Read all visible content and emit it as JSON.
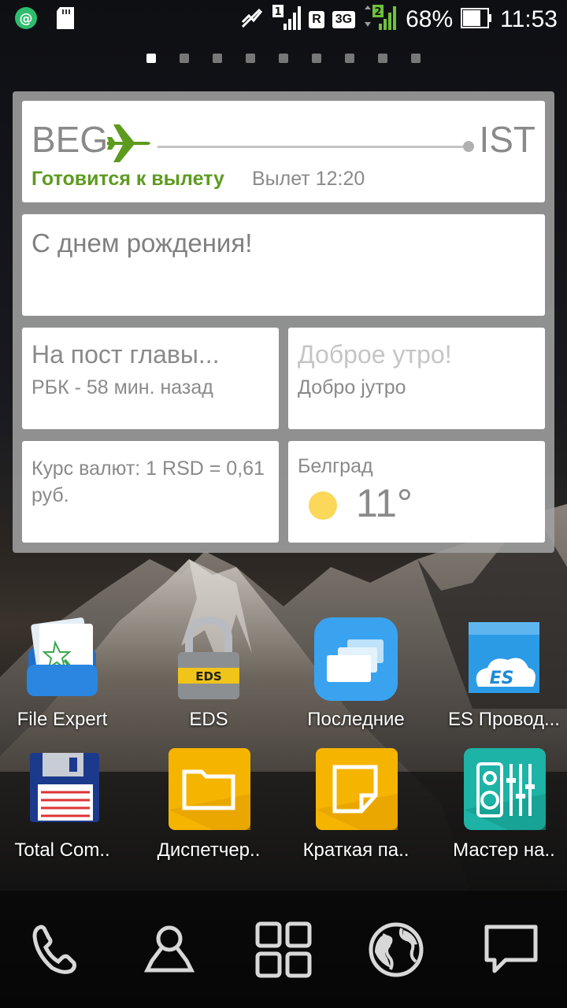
{
  "status_bar": {
    "battery_percent": "68%",
    "time": "11:53",
    "sim1": "1",
    "sim2": "2",
    "roaming": "R",
    "network": "3G"
  },
  "pages": {
    "count": 9,
    "active": 0
  },
  "flight": {
    "from": "BEG",
    "to": "IST",
    "status": "Готовится к вылету",
    "departure": "Вылет 12:20"
  },
  "birthday": {
    "text": "С днем рождения!"
  },
  "news": {
    "title": "На пост главы...",
    "source": "РБК - 58 мин. назад"
  },
  "greeting": {
    "title": "Доброе утро!",
    "translation": "Добро јутро"
  },
  "currency": {
    "text": "Курс валют: 1 RSD = 0,61 руб."
  },
  "weather": {
    "city": "Белград",
    "temperature": "11°"
  },
  "apps": [
    {
      "label": "File Expert",
      "icon": "file-expert-icon"
    },
    {
      "label": "EDS",
      "icon": "eds-lock-icon"
    },
    {
      "label": "Последние",
      "icon": "recents-icon"
    },
    {
      "label": "ES Провод...",
      "icon": "es-explorer-icon"
    },
    {
      "label": "Total Com..",
      "icon": "floppy-disk-icon"
    },
    {
      "label": "Диспетчер..",
      "icon": "folder-icon"
    },
    {
      "label": "Краткая па..",
      "icon": "note-icon"
    },
    {
      "label": "Мастер на..",
      "icon": "equalizer-icon"
    }
  ],
  "dock": [
    "phone-icon",
    "contacts-icon",
    "app-drawer-icon",
    "browser-globe-icon",
    "messages-icon"
  ]
}
